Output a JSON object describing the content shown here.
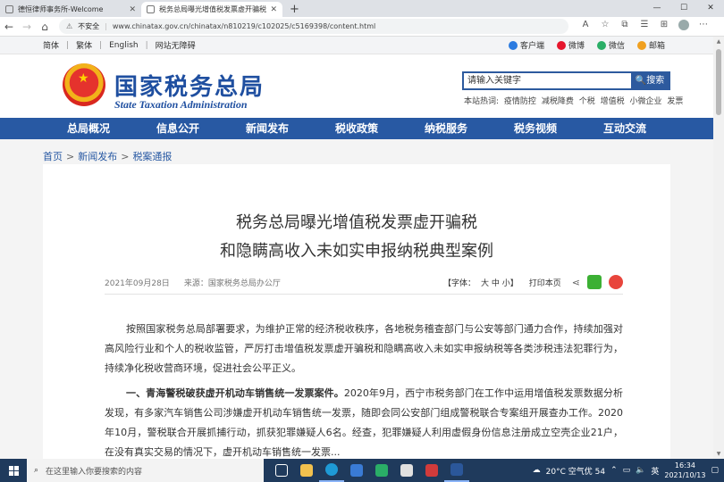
{
  "browser": {
    "tabs": [
      {
        "title": "德恒律师事务所-Welcome",
        "active": false
      },
      {
        "title": "税务总局曝光增值税发票虚开骗税",
        "active": true
      }
    ],
    "new_tab": "+",
    "security": "不安全",
    "url": "www.chinatax.gov.cn/chinatax/n810219/c102025/c5169398/content.html"
  },
  "topstrip": {
    "left": [
      "简体",
      "繁体",
      "English",
      "网站无障碍"
    ],
    "right": [
      "客户端",
      "微博",
      "微信",
      "邮箱"
    ]
  },
  "header": {
    "site_name": "国家税务总局",
    "site_name_en": "State Taxation Administration",
    "search_placeholder": "请输入关键字",
    "search_button": "搜索",
    "hotwords_label": "本站热词:",
    "hotwords": [
      "疫情防控",
      "减税降费",
      "个税",
      "增值税",
      "小微企业",
      "发票"
    ]
  },
  "nav": [
    "总局概况",
    "信息公开",
    "新闻发布",
    "税收政策",
    "纳税服务",
    "税务视频",
    "互动交流"
  ],
  "breadcrumb": [
    "首页",
    "新闻发布",
    "税案通报"
  ],
  "article": {
    "title_line1": "税务总局曝光增值税发票虚开骗税",
    "title_line2": "和隐瞒高收入未如实申报纳税典型案例",
    "date": "2021年09月28日",
    "source": "来源：国家税务总局办公厅",
    "font_label": "【字体：",
    "font_sizes": "大 中 小】",
    "print": "打印本页",
    "para1": "按照国家税务总局部署要求，为维护正常的经济税收秩序，各地税务稽查部门与公安等部门通力合作，持续加强对高风险行业和个人的税收监管，严厉打击增值税发票虚开骗税和隐瞒高收入未如实申报纳税等各类涉税违法犯罪行为，持续净化税收营商环境，促进社会公平正义。",
    "para2_bold": "一、青海警税破获虚开机动车销售统一发票案件。",
    "para2_rest": "2020年9月，西宁市税务部门在工作中运用增值税发票数据分析发现，有多家汽车销售公司涉嫌虚开机动车销售统一发票，随即会同公安部门组成警税联合专案组开展查办工作。2020年10月，警税联合开展抓捕行动，抓获犯罪嫌疑人6名。经查，犯罪嫌疑人利用虚假身份信息注册成立空壳企业21户，在没有真实交易的情况下，虚开机动车销售统一发票..."
  },
  "taskbar": {
    "search_placeholder": "在这里输入你要搜索的内容",
    "weather": "20°C 空气优 54",
    "ime": "英",
    "time": "16:34",
    "date": "2021/10/13"
  },
  "colors": {
    "brand_blue": "#2859a3",
    "nav_bg": "#2859a3"
  }
}
